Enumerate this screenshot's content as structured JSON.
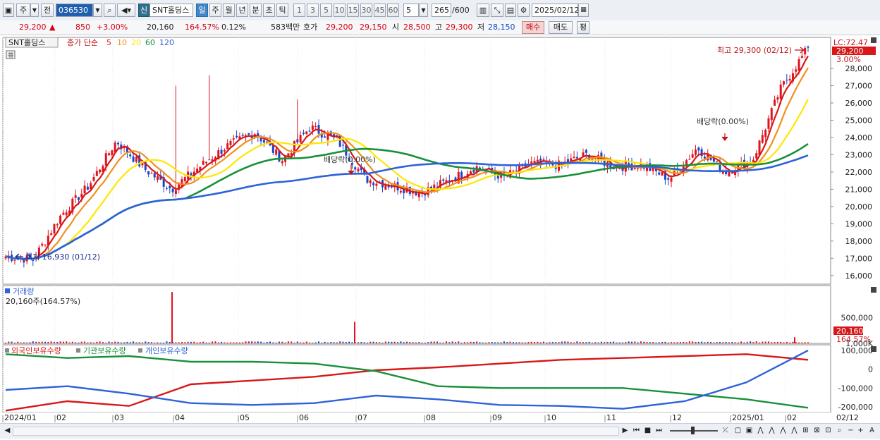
{
  "toolbar": {
    "market": "주",
    "prev": "전",
    "code": "036530",
    "credit_badge": "신",
    "stock_name": "SNT홀딩스",
    "periods": [
      "일",
      "주",
      "월",
      "년",
      "분",
      "초",
      "틱"
    ],
    "active_period": "일",
    "intervals": [
      "1",
      "3",
      "5",
      "10",
      "15",
      "30",
      "45",
      "60"
    ],
    "interval_value": "5",
    "count": "265",
    "count_max": "/600",
    "date": "2025/02/12"
  },
  "quote": {
    "price": "29,200",
    "change": "850",
    "change_pct": "+3.00%",
    "volume": "20,160",
    "vol_ratio": "164.57%",
    "turnover": "0.12%",
    "amount": "583백만",
    "ask_label": "호가",
    "ask": "29,200",
    "bid": "29,150",
    "open_label": "시",
    "open": "28,500",
    "high_label": "고",
    "high": "29,300",
    "low_label": "저",
    "low": "28,150",
    "buy_button": "매수",
    "sell_button": "매도",
    "eval_button": "평"
  },
  "legend": {
    "stock": "SNT홀딩스",
    "ma_label": "종가 단순",
    "ma_periods": [
      "5",
      "10",
      "20",
      "60",
      "120"
    ],
    "ma_colors": [
      "#d81818",
      "#f0901e",
      "#ffe600",
      "#18903a",
      "#2e62d8"
    ]
  },
  "price_panel": {
    "lc": "LC:72.47",
    "current_tag": "29,200",
    "change_tag": "3.00%",
    "high_note": "최고 29,300 (02/12)",
    "low_note": "최저 16,930 (01/12)",
    "dividend_notes": [
      "배당락(0.00%)",
      "배당락(0.00%)"
    ]
  },
  "volume_panel": {
    "title": "거래량",
    "summary": "20,160주(164.57%)",
    "tag": "20,160",
    "tag2": "164.57%"
  },
  "holding_panel": {
    "foreign": "외국인보유수량",
    "institution": "기관보유수량",
    "individual": "개인보유수량"
  },
  "x_axis": {
    "labels": [
      "2024/01",
      "02",
      "03",
      "04",
      "05",
      "06",
      "07",
      "08",
      "09",
      "10",
      "11",
      "12",
      "2025/01",
      "02"
    ],
    "end_label": "02/12"
  },
  "chart_data": [
    {
      "type": "candlestick",
      "title": "SNT홀딩스",
      "ylim": [
        15500,
        29800
      ],
      "yticks": [
        "16,000",
        "17,000",
        "18,000",
        "19,000",
        "20,000",
        "21,000",
        "22,000",
        "23,000",
        "24,000",
        "25,000",
        "26,000",
        "27,000",
        "28,000"
      ],
      "close_anchors": [
        {
          "x": "2024/01",
          "y": 17100
        },
        {
          "x": "01/12",
          "y": 16930
        },
        {
          "x": "02",
          "y": 19500
        },
        {
          "x": "02 late",
          "y": 21200
        },
        {
          "x": "03 early",
          "y": 23800
        },
        {
          "x": "03 mid",
          "y": 22200
        },
        {
          "x": "03 late",
          "y": 21000
        },
        {
          "x": "04",
          "y": 22300
        },
        {
          "x": "04 mid",
          "y": 23500
        },
        {
          "x": "04 late",
          "y": 24300
        },
        {
          "x": "05",
          "y": 22700
        },
        {
          "x": "05 mid",
          "y": 24600
        },
        {
          "x": "05 late",
          "y": 23800
        },
        {
          "x": "06",
          "y": 21600
        },
        {
          "x": "06 late",
          "y": 21200
        },
        {
          "x": "07",
          "y": 20800
        },
        {
          "x": "07 mid",
          "y": 21500
        },
        {
          "x": "08",
          "y": 22300
        },
        {
          "x": "08 mid",
          "y": 21700
        },
        {
          "x": "09",
          "y": 22500
        },
        {
          "x": "10",
          "y": 22400
        },
        {
          "x": "10 late",
          "y": 23000
        },
        {
          "x": "11",
          "y": 22300
        },
        {
          "x": "12",
          "y": 22400
        },
        {
          "x": "12 mid",
          "y": 21600
        },
        {
          "x": "2025/01",
          "y": 23400
        },
        {
          "x": "01 mid",
          "y": 22000
        },
        {
          "x": "01 late",
          "y": 22700
        },
        {
          "x": "02",
          "y": 26800
        },
        {
          "x": "02/12",
          "y": 29200
        }
      ],
      "high": {
        "value": 29300,
        "date": "02/12"
      },
      "low": {
        "value": 16930,
        "date": "01/12"
      }
    },
    {
      "type": "bar",
      "title": "거래량",
      "ylim": [
        0,
        1100000
      ],
      "yticks": [
        "1,000K",
        "500,000"
      ],
      "spikes": [
        {
          "x": "04",
          "value": 1000000
        },
        {
          "x": "07",
          "value": 420000
        },
        {
          "x": "02",
          "value": 120000
        }
      ],
      "last": 20160
    },
    {
      "type": "line",
      "ylim": [
        -230000,
        130000
      ],
      "yticks": [
        "100,000",
        "0",
        "-100,000",
        "-200,000"
      ],
      "series": [
        {
          "name": "외국인보유수량",
          "color": "#d81818",
          "values": [
            -220000,
            -170000,
            -195000,
            -80000,
            -60000,
            -40000,
            -5000,
            10000,
            30000,
            50000,
            60000,
            70000,
            80000,
            50000
          ]
        },
        {
          "name": "기관보유수량",
          "color": "#18903a",
          "values": [
            80000,
            60000,
            70000,
            40000,
            40000,
            30000,
            -10000,
            -90000,
            -100000,
            -100000,
            -100000,
            -130000,
            -160000,
            -205000
          ]
        },
        {
          "name": "개인보유수량",
          "color": "#2e62d8",
          "values": [
            -110000,
            -90000,
            -130000,
            -180000,
            -190000,
            -180000,
            -140000,
            -160000,
            -190000,
            -195000,
            -210000,
            -170000,
            -70000,
            100000
          ]
        }
      ]
    }
  ]
}
